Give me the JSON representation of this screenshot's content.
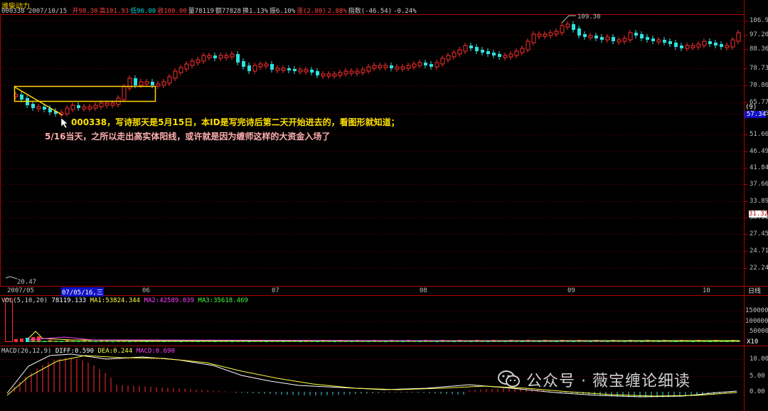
{
  "stock": {
    "name": "潍柴动力"
  },
  "header": {
    "code_date": "000338 2007/10/15",
    "items": [
      {
        "label": "开",
        "value": "98.30",
        "color": "#ff4040"
      },
      {
        "label": "高",
        "value": "101.93",
        "color": "#ff4040"
      },
      {
        "label": "低",
        "value": "96.00",
        "color": "#00d8d8"
      },
      {
        "label": "收",
        "value": "100.00",
        "color": "#ff4040"
      },
      {
        "label": "量",
        "value": "78119",
        "color": "#d0d0d0"
      },
      {
        "label": "额",
        "value": "77828",
        "color": "#d0d0d0"
      },
      {
        "label": "换",
        "value": "1.13%",
        "color": "#d0d0d0"
      },
      {
        "label": "振",
        "value": "6.10%",
        "color": "#d0d0d0"
      },
      {
        "label": "涨",
        "value": "(2.80)",
        "color": "#ff4040"
      },
      {
        "label": "",
        "value": "2.88%",
        "color": "#ff4040"
      },
      {
        "label": "指数",
        "value": "(-46.54)",
        "color": "#d0d0d0"
      },
      {
        "label": "",
        "value": "-0.24%",
        "color": "#d0d0d0"
      }
    ]
  },
  "price_axis": [
    "106.92",
    "97.20",
    "88.36",
    "78.73",
    "70.86",
    "65.77",
    "61.35",
    "51.66",
    "46.49",
    "41.84",
    "37.66",
    "33.89",
    "30.50",
    "27.45",
    "24.71",
    "22.24"
  ],
  "price_badges": {
    "pct": "(9)",
    "value": "57.34",
    "current": "31.32"
  },
  "markers": {
    "high": "109.30",
    "low": "20.47"
  },
  "time_axis": {
    "start": "2007/05",
    "selected": "07/05/16,三",
    "months": [
      "06",
      "07",
      "08",
      "09",
      "10"
    ],
    "period": "日线"
  },
  "annotations": {
    "line1": "000338，写诗那天是5月15日，本ID是写完诗后第二天开始进去的，看图形就知道；",
    "line2": "5/16当天，之所以走出高实体阳线，或许就是因为缠师这样的大资金入场了"
  },
  "volume": {
    "title": "VOL(5,10,20)",
    "value": "78119.133",
    "ma1": "MA1:53824.344",
    "ma2": "MA2:42589.039",
    "ma3": "MA3:35618.469",
    "axis": [
      "150000",
      "100000",
      "50000"
    ],
    "unit": "X10"
  },
  "macd": {
    "title": "MACD(26,12,9)",
    "diff": "DIFF:0.590",
    "dea": "DEA:0.244",
    "macd": "MACD:0.690",
    "axis": [
      "10.00",
      "5.00",
      "0.00"
    ]
  },
  "watermark": "公众号 · 薇宝缠论细读",
  "colors": {
    "up": "#ff3030",
    "down": "#30e0e0",
    "annot_yellow": "#ffe000",
    "annot_pink": "#ffb0b0"
  }
}
